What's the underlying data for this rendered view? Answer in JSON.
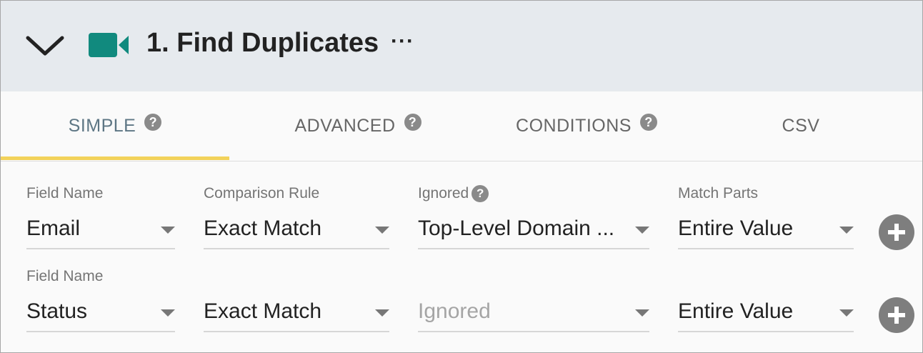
{
  "header": {
    "title": "1. Find Duplicates",
    "more_label": "···",
    "icons": {
      "collapse": "chevron-down-icon",
      "step": "video-camera-icon"
    },
    "accent_color": "#118a7e"
  },
  "tabs": [
    {
      "label": "SIMPLE",
      "help": "?",
      "active": true
    },
    {
      "label": "ADVANCED",
      "help": "?",
      "active": false
    },
    {
      "label": "CONDITIONS",
      "help": "?",
      "active": false
    },
    {
      "label": "CSV",
      "help": "",
      "active": false
    }
  ],
  "rows": [
    {
      "field_label": "Field Name",
      "field_value": "Email",
      "rule_label": "Comparison Rule",
      "rule_value": "Exact Match",
      "ignored_label": "Ignored",
      "ignored_help": "?",
      "ignored_value": "Top-Level Domain ...",
      "match_label": "Match Parts",
      "match_value": "Entire Value"
    },
    {
      "field_label": "Field Name",
      "field_value": "Status",
      "rule_value": "Exact Match",
      "ignored_placeholder": "Ignored",
      "match_value": "Entire Value"
    }
  ]
}
